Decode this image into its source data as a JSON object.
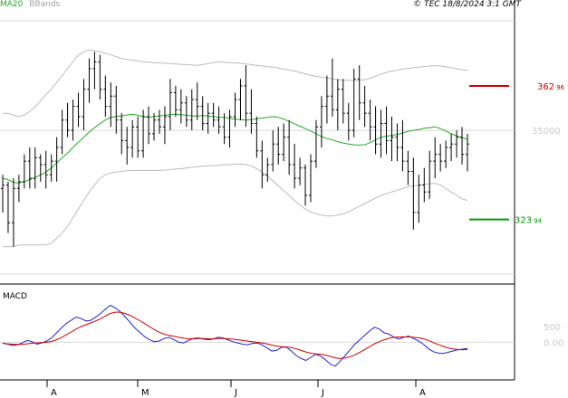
{
  "header": {
    "legend_ma": "MA20",
    "legend_bb": "BBands",
    "copyright": "© TEC 18/8/2024 3:1 GMT"
  },
  "macd_title": "MACD",
  "chart_data": [
    {
      "type": "candlestick",
      "title": "",
      "yaxis_labels": [
        "35000"
      ],
      "ylim": [
        30800,
        38200
      ],
      "x_months": [
        "A",
        "M",
        "J",
        "J",
        "A"
      ],
      "resistance": {
        "label": "362",
        "label_suffix": "96",
        "value": 36296,
        "color": "#cc0000"
      },
      "support": {
        "label": "323",
        "label_suffix": "94",
        "value": 32394,
        "color": "#009900"
      },
      "series": [
        {
          "name": "MA20",
          "color": "#22aa22",
          "values": [
            33600,
            33560,
            33480,
            33460,
            33500,
            33560,
            33620,
            33700,
            33780,
            33900,
            34050,
            34200,
            34330,
            34500,
            34650,
            34800,
            34950,
            35080,
            35200,
            35300,
            35380,
            35400,
            35420,
            35450,
            35470,
            35440,
            35400,
            35380,
            35400,
            35420,
            35440,
            35460,
            35470,
            35460,
            35440,
            35420,
            35420,
            35430,
            35420,
            35400,
            35380,
            35380,
            35350,
            35330,
            35310,
            35300,
            35310,
            35340,
            35360,
            35380,
            35400,
            35380,
            35330,
            35260,
            35190,
            35120,
            35050,
            34980,
            34900,
            34820,
            34760,
            34720,
            34670,
            34630,
            34600,
            34580,
            34570,
            34580,
            34640,
            34720,
            34800,
            34830,
            34850,
            34880,
            34920,
            34970,
            35000,
            35020,
            35060,
            35080,
            35100,
            35050,
            34980,
            34900,
            34840,
            34780,
            34740
          ]
        },
        {
          "name": "BBandUpper",
          "color": "#bbbbbb",
          "values": [
            35500,
            35500,
            35450,
            35400,
            35450,
            35550,
            35700,
            35850,
            36050,
            36200,
            36400,
            36600,
            36800,
            37000,
            37200,
            37300,
            37350,
            37330,
            37300,
            37250,
            37200,
            37150,
            37100,
            37070,
            37050,
            37030,
            37000,
            36990,
            36980,
            36970,
            36960,
            36950,
            36940,
            36930,
            36920,
            36910,
            36900,
            36920,
            36950,
            36980,
            37000,
            36990,
            36980,
            36970,
            36960,
            36940,
            36920,
            36900,
            36880,
            36860,
            36850,
            36820,
            36790,
            36760,
            36730,
            36690,
            36650,
            36610,
            36580,
            36550,
            36530,
            36500,
            36480,
            36470,
            36460,
            36450,
            36460,
            36480,
            36520,
            36580,
            36640,
            36690,
            36730,
            36760,
            36790,
            36810,
            36830,
            36850,
            36860,
            36880,
            36890,
            36880,
            36860,
            36830,
            36800,
            36770,
            36750
          ]
        },
        {
          "name": "BBandLower",
          "color": "#bbbbbb",
          "values": [
            31600,
            31600,
            31600,
            31650,
            31650,
            31650,
            31650,
            31650,
            31650,
            31700,
            31850,
            32000,
            32200,
            32450,
            32700,
            32950,
            33200,
            33400,
            33600,
            33700,
            33750,
            33780,
            33800,
            33820,
            33830,
            33830,
            33830,
            33830,
            33830,
            33830,
            33840,
            33850,
            33870,
            33880,
            33900,
            33920,
            33940,
            33950,
            33960,
            33970,
            33980,
            33990,
            34000,
            34010,
            34020,
            34000,
            33950,
            33880,
            33780,
            33660,
            33520,
            33380,
            33240,
            33100,
            32950,
            32820,
            32700,
            32620,
            32560,
            32520,
            32500,
            32500,
            32520,
            32560,
            32620,
            32700,
            32780,
            32860,
            32940,
            33020,
            33100,
            33150,
            33200,
            33250,
            33300,
            33350,
            33380,
            33400,
            33420,
            33440,
            33450,
            33400,
            33300,
            33200,
            33100,
            33000,
            32950
          ]
        },
        {
          "name": "Price",
          "type": "ohlc",
          "color": "#000000",
          "values": [
            [
              33300,
              33700,
              32600,
              33400
            ],
            [
              33400,
              33500,
              32000,
              32300
            ],
            [
              32300,
              33600,
              31600,
              33300
            ],
            [
              33300,
              33700,
              32900,
              33500
            ],
            [
              33500,
              34300,
              33300,
              34100
            ],
            [
              34100,
              34500,
              33300,
              33600
            ],
            [
              33600,
              34500,
              33300,
              34200
            ],
            [
              34200,
              34300,
              33500,
              34000
            ],
            [
              34000,
              34400,
              33300,
              33700
            ],
            [
              33700,
              34300,
              33500,
              34100
            ],
            [
              34100,
              34800,
              33500,
              34500
            ],
            [
              34500,
              35600,
              34300,
              35300
            ],
            [
              35300,
              35800,
              34800,
              35000
            ],
            [
              35000,
              35900,
              34700,
              35700
            ],
            [
              35700,
              36100,
              35100,
              35400
            ],
            [
              35400,
              36500,
              35000,
              36200
            ],
            [
              36200,
              37100,
              35800,
              36800
            ],
            [
              36800,
              37300,
              36200,
              37000
            ],
            [
              37000,
              37200,
              35900,
              36200
            ],
            [
              36200,
              36600,
              35400,
              35700
            ],
            [
              35700,
              36400,
              35100,
              36000
            ],
            [
              36000,
              36300,
              34900,
              35300
            ],
            [
              35300,
              35500,
              34300,
              34700
            ],
            [
              34700,
              35100,
              34000,
              34500
            ],
            [
              34500,
              35300,
              34200,
              35100
            ],
            [
              35100,
              35400,
              34200,
              34400
            ],
            [
              34400,
              35600,
              34200,
              35400
            ],
            [
              35400,
              35700,
              34600,
              34900
            ],
            [
              34900,
              35500,
              34700,
              35300
            ],
            [
              35300,
              35600,
              34900,
              35100
            ],
            [
              35100,
              35700,
              34600,
              35400
            ],
            [
              35400,
              36500,
              35000,
              36100
            ],
            [
              36100,
              36300,
              35400,
              35600
            ],
            [
              35600,
              36200,
              35200,
              35800
            ],
            [
              35800,
              36000,
              35100,
              35300
            ],
            [
              35300,
              36200,
              35000,
              35900
            ],
            [
              35900,
              36400,
              35300,
              35700
            ],
            [
              35700,
              36000,
              35000,
              35200
            ],
            [
              35200,
              35800,
              34900,
              35500
            ],
            [
              35500,
              35800,
              35100,
              35300
            ],
            [
              35300,
              35700,
              34900,
              35100
            ],
            [
              35100,
              35500,
              34600,
              34800
            ],
            [
              34800,
              35600,
              34500,
              35400
            ],
            [
              35400,
              36100,
              35100,
              35900
            ],
            [
              35900,
              36500,
              35300,
              36300
            ],
            [
              36300,
              36900,
              35100,
              35500
            ],
            [
              35500,
              36200,
              34900,
              35200
            ],
            [
              35200,
              35400,
              34200,
              34400
            ],
            [
              34400,
              34700,
              33300,
              33700
            ],
            [
              33700,
              34200,
              33500,
              34000
            ],
            [
              34000,
              35000,
              33800,
              34600
            ],
            [
              34600,
              35100,
              34000,
              34300
            ],
            [
              34300,
              35200,
              34100,
              34800
            ],
            [
              34800,
              35300,
              33700,
              34000
            ],
            [
              34000,
              34600,
              33300,
              33600
            ],
            [
              33600,
              34200,
              33400,
              33900
            ],
            [
              33900,
              34000,
              32800,
              33100
            ],
            [
              33100,
              34300,
              32900,
              34100
            ],
            [
              34100,
              35300,
              33900,
              35100
            ],
            [
              35100,
              36000,
              34500,
              35700
            ],
            [
              35700,
              36600,
              35200,
              36000
            ],
            [
              36000,
              37100,
              35400,
              35600
            ],
            [
              35600,
              36500,
              35000,
              36200
            ],
            [
              36200,
              36500,
              35200,
              35500
            ],
            [
              35500,
              35800,
              34700,
              35000
            ],
            [
              35000,
              36800,
              34800,
              36500
            ],
            [
              36500,
              36900,
              35300,
              35800
            ],
            [
              35800,
              36300,
              35100,
              35500
            ],
            [
              35500,
              35900,
              34700,
              35100
            ],
            [
              35100,
              35700,
              34300,
              34600
            ],
            [
              34600,
              35600,
              34200,
              35200
            ],
            [
              35200,
              35700,
              34300,
              34700
            ],
            [
              34700,
              35400,
              34100,
              34800
            ],
            [
              34800,
              35200,
              34100,
              34500
            ],
            [
              34500,
              35300,
              33800,
              34100
            ],
            [
              34100,
              34400,
              33400,
              33800
            ],
            [
              33800,
              34200,
              32100,
              32600
            ],
            [
              32600,
              33700,
              32300,
              33400
            ],
            [
              33400,
              33900,
              32900,
              33200
            ],
            [
              33200,
              34400,
              33000,
              34100
            ],
            [
              34100,
              34800,
              33600,
              34300
            ],
            [
              34300,
              34600,
              33800,
              34100
            ],
            [
              34100,
              34700,
              33900,
              34500
            ],
            [
              34500,
              34900,
              34100,
              34600
            ],
            [
              34600,
              35000,
              34200,
              34800
            ],
            [
              34800,
              35100,
              34000,
              34300
            ],
            [
              34300,
              34900,
              33800,
              34600
            ]
          ]
        }
      ]
    },
    {
      "type": "line",
      "title": "MACD",
      "yaxis_labels": [
        "500",
        "0.00"
      ],
      "ylim": [
        -1200,
        1800
      ],
      "series": [
        {
          "name": "MACD",
          "color": "#2222cc",
          "values": [
            -20,
            -60,
            -100,
            -80,
            -20,
            60,
            20,
            -60,
            -20,
            40,
            140,
            300,
            460,
            600,
            700,
            800,
            760,
            680,
            700,
            800,
            920,
            1060,
            1180,
            1100,
            980,
            820,
            640,
            460,
            320,
            180,
            80,
            20,
            40,
            120,
            160,
            80,
            0,
            -20,
            60,
            120,
            140,
            100,
            80,
            100,
            160,
            140,
            80,
            20,
            -20,
            -60,
            -80,
            -40,
            -20,
            -80,
            -180,
            -280,
            -260,
            -160,
            -160,
            -280,
            -420,
            -520,
            -580,
            -480,
            -380,
            -440,
            -560,
            -700,
            -760,
            -600,
            -420,
            -240,
            -60,
            80,
            220,
            360,
            480,
            420,
            300,
            260,
            160,
            100,
            160,
            200,
            120,
            40,
            -60,
            -200,
            -300,
            -340,
            -360,
            -320,
            -280,
            -240,
            -220,
            -200
          ]
        },
        {
          "name": "Signal",
          "color": "#cc0000",
          "values": [
            -40,
            -50,
            -60,
            -70,
            -70,
            -50,
            -30,
            -20,
            -10,
            0,
            30,
            80,
            150,
            240,
            330,
            420,
            500,
            560,
            620,
            680,
            750,
            840,
            920,
            960,
            960,
            920,
            860,
            780,
            690,
            600,
            500,
            400,
            320,
            260,
            220,
            190,
            160,
            130,
            110,
            110,
            120,
            120,
            110,
            110,
            120,
            120,
            110,
            100,
            80,
            60,
            40,
            20,
            0,
            -20,
            -50,
            -90,
            -120,
            -140,
            -150,
            -170,
            -210,
            -260,
            -310,
            -350,
            -370,
            -380,
            -410,
            -450,
            -500,
            -520,
            -500,
            -460,
            -400,
            -320,
            -230,
            -140,
            -50,
            20,
            80,
            130,
            160,
            170,
            170,
            170,
            160,
            140,
            110,
            60,
            -10,
            -70,
            -130,
            -180,
            -210,
            -230,
            -240,
            -230
          ]
        }
      ]
    }
  ]
}
